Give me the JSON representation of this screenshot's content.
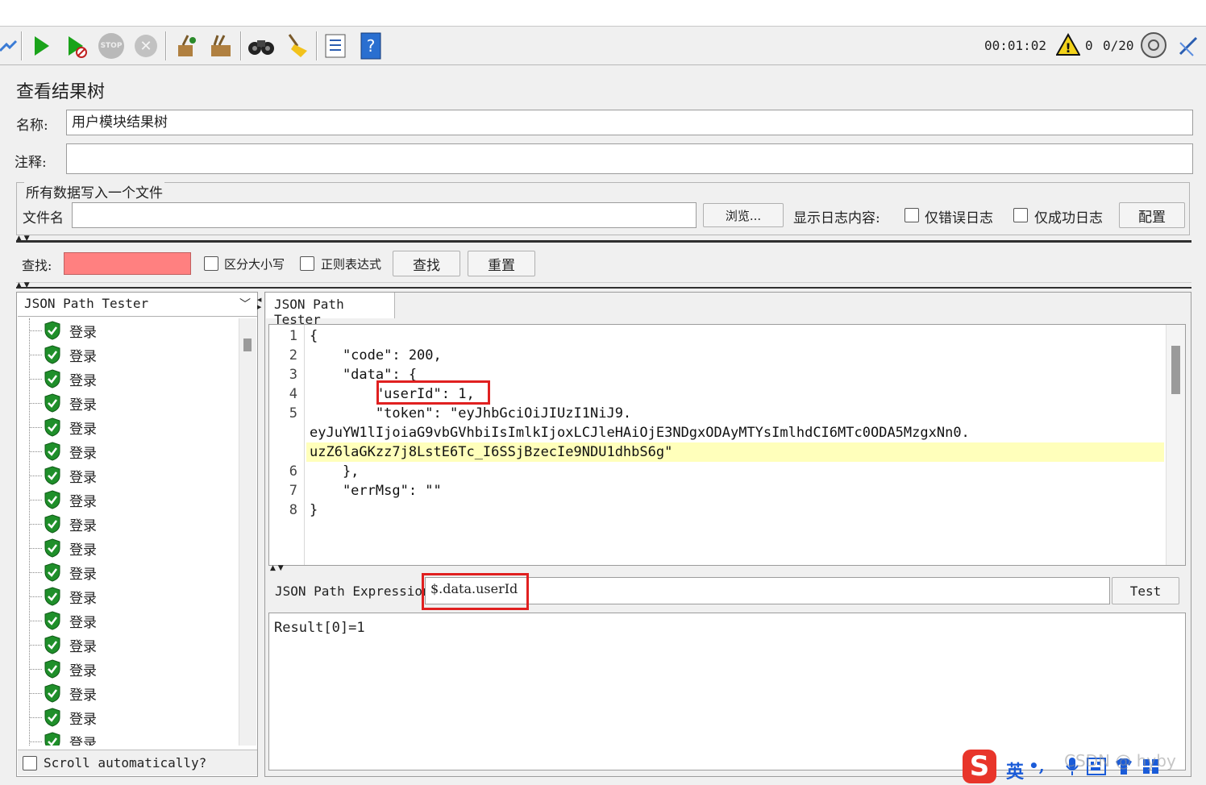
{
  "toolbar": {
    "timer": "00:01:02",
    "warning_count": "0",
    "threads": "0/20",
    "stop_label": "STOP"
  },
  "panel": {
    "title": "查看结果树",
    "name_label": "名称:",
    "name_value": "用户模块结果树",
    "comment_label": "注释:",
    "comment_value": "",
    "group_legend": "所有数据写入一个文件",
    "file_label": "文件名",
    "file_value": "",
    "browse_button": "浏览...",
    "log_label": "显示日志内容:",
    "errors_only": "仅错误日志",
    "success_only": "仅成功日志",
    "configure_button": "配置"
  },
  "search": {
    "label": "查找:",
    "value": "",
    "case_sensitive": "区分大小写",
    "regex": "正则表达式",
    "find_button": "查找",
    "reset_button": "重置"
  },
  "left": {
    "renderer": "JSON Path Tester",
    "tree_items": [
      "登录",
      "登录",
      "登录",
      "登录",
      "登录",
      "登录",
      "登录",
      "登录",
      "登录",
      "登录",
      "登录",
      "登录",
      "登录",
      "登录",
      "登录",
      "登录",
      "登录",
      "登录"
    ],
    "scroll_auto": "Scroll automatically?"
  },
  "right": {
    "tab": "JSON Path Tester",
    "line_numbers": [
      "1",
      "2",
      "3",
      "4",
      "5",
      "",
      "",
      "6",
      "7",
      "8"
    ],
    "code_lines": [
      "{",
      "    \"code\": 200,",
      "    \"data\": {",
      "        \"userId\": 1,",
      "        \"token\": \"eyJhbGciOiJIUzI1NiJ9.",
      "eyJuYW1lIjoiaG9vbGVhbiIsImlkIjoxLCJleHAiOjE3NDgxODAyMTYsImlhdCI6MTc0ODA5MzgxNn0.",
      "uzZ6laGKzz7j8LstE6Tc_I6SSjBzecIe9NDU1dhbS6g\"",
      "    },",
      "    \"errMsg\": \"\"",
      "}"
    ],
    "expr_label": "JSON Path Expression",
    "expr_value": "$.data.userId",
    "test_button": "Test",
    "result": "Result[0]=1"
  },
  "ime": {
    "logo": "S",
    "lang": "英",
    "punct": "•,",
    "watermark": "CSDN @ hyby"
  },
  "colors": {
    "search_field": "#ff8080",
    "highlight_line": "#ffffbb",
    "annotation": "#e02020",
    "play": "#1aa31a"
  }
}
